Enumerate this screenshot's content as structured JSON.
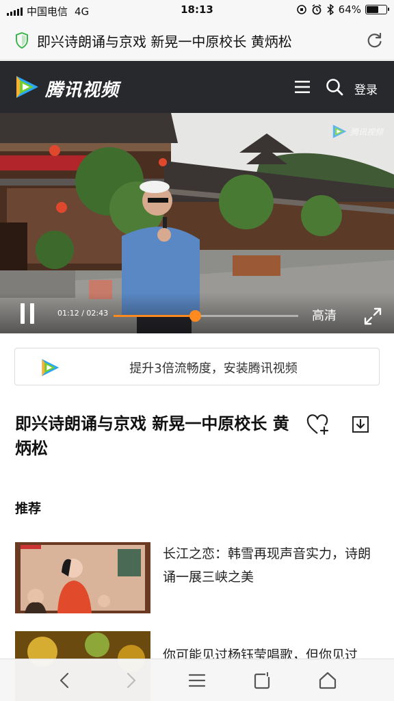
{
  "status_bar": {
    "carrier": "中国电信",
    "network": "4G",
    "time": "18:13",
    "battery_percent_text": "64%",
    "battery_level": 0.64
  },
  "address_bar": {
    "title": "即兴诗朗诵与京戏 新晃一中原校长 黄炳松"
  },
  "header": {
    "logo_text": "腾讯视频",
    "login_label": "登录"
  },
  "player": {
    "current_time": "01:12",
    "duration": "02:43",
    "time_separator": " / ",
    "progress": 0.44,
    "quality_label": "高清"
  },
  "install_banner": {
    "text": "提升3倍流畅度，安装腾讯视频"
  },
  "video": {
    "title": "即兴诗朗诵与京戏 新晃一中原校长 黄炳松"
  },
  "recommendations": {
    "heading": "推荐",
    "items": [
      {
        "title": "长江之恋：韩雪再现声音实力，诗朗诵一展三峡之美"
      },
      {
        "title": "你可能见过杨钰莹唱歌，但你见过"
      }
    ]
  },
  "colors": {
    "header_bg": "#28292c",
    "accent_orange": "#ff8a1f",
    "logo_blue": "#2aa5f5",
    "logo_green": "#6fcf2f",
    "logo_orange": "#ffb02e"
  }
}
